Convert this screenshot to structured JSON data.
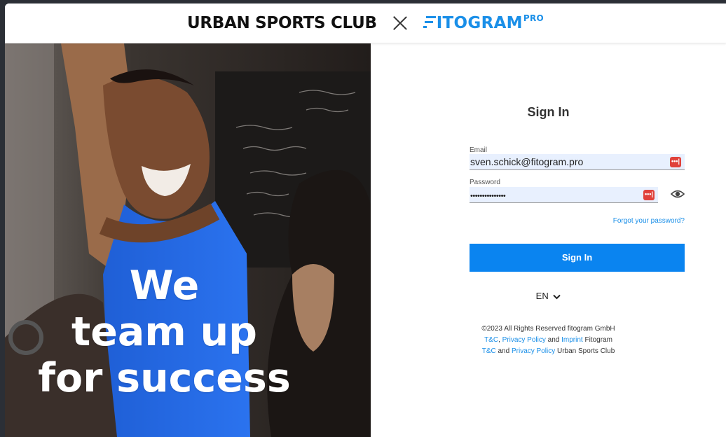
{
  "header": {
    "brand_left": "URBAN SPORTS CLUB",
    "brand_right": "ITOGRAM",
    "brand_right_super": "PRO"
  },
  "hero": {
    "line1": "We",
    "line2": "team up",
    "line3": "for success"
  },
  "form": {
    "title": "Sign In",
    "email_label": "Email",
    "email_value": "sven.schick@fitogram.pro",
    "password_label": "Password",
    "password_value": "•••••••••••••••",
    "password_manager_badge": "•••|",
    "forgot_link": "Forgot your password?",
    "submit_label": "Sign In",
    "language": "EN"
  },
  "footer": {
    "copyright": "©2023 All Rights Reserved fitogram GmbH",
    "line2_tc": "T&C",
    "line2_sep1": ", ",
    "line2_privacy": "Privacy Policy",
    "line2_and": " and ",
    "line2_imprint": "Imprint",
    "line2_suffix": " Fitogram",
    "line3_tc": "T&C",
    "line3_and": " and ",
    "line3_privacy": "Privacy Policy",
    "line3_suffix": " Urban Sports Club"
  },
  "colors": {
    "accent": "#0a84f0",
    "link": "#1a8fe8",
    "autofill_bg": "#e8f0fe",
    "password_manager": "#e0423b"
  },
  "icons": [
    "close-x-icon",
    "password-manager-icon",
    "eye-icon",
    "chevron-down-icon"
  ]
}
